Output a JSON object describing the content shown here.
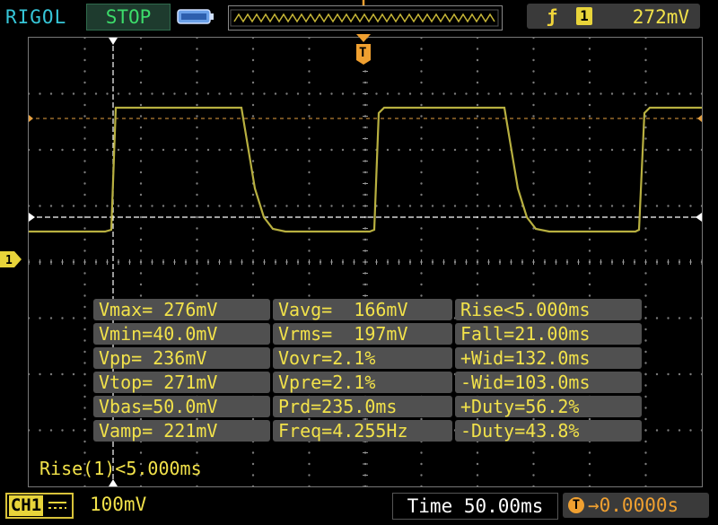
{
  "header": {
    "brand": "RIGOL",
    "run_state": "STOP",
    "trigger": {
      "edge_icon": "rising-edge-icon",
      "source": "1",
      "level": "272mV"
    }
  },
  "channel": {
    "label": "CH1",
    "marker": "1",
    "scale": "100mV"
  },
  "timebase": "Time  50.00ms",
  "trigger_offset": {
    "marker": "T",
    "value": "→0.0000s"
  },
  "measurements": [
    [
      "Vmax= 276mV",
      "Vavg=  166mV",
      "Rise<5.000ms"
    ],
    [
      "Vmin=40.0mV",
      "Vrms=  197mV",
      "Fall=21.00ms"
    ],
    [
      "Vpp= 236mV",
      "Vovr=2.1%",
      "+Wid=132.0ms"
    ],
    [
      "Vtop= 271mV",
      "Vpre=2.1%",
      "-Wid=103.0ms"
    ],
    [
      "Vbas=50.0mV",
      "Prd=235.0ms",
      "+Duty=56.2%"
    ],
    [
      "Vamp= 221mV",
      "Freq=4.255Hz",
      "-Duty=43.8%"
    ]
  ],
  "cursor_readout": "Rise(1)<5.000ms",
  "colors": {
    "trace": "#b8b040",
    "measure_text": "#f2e24a",
    "trigger": "#f0a030",
    "status_green": "#3cdc6a",
    "brand_cyan": "#36c6d8"
  }
}
